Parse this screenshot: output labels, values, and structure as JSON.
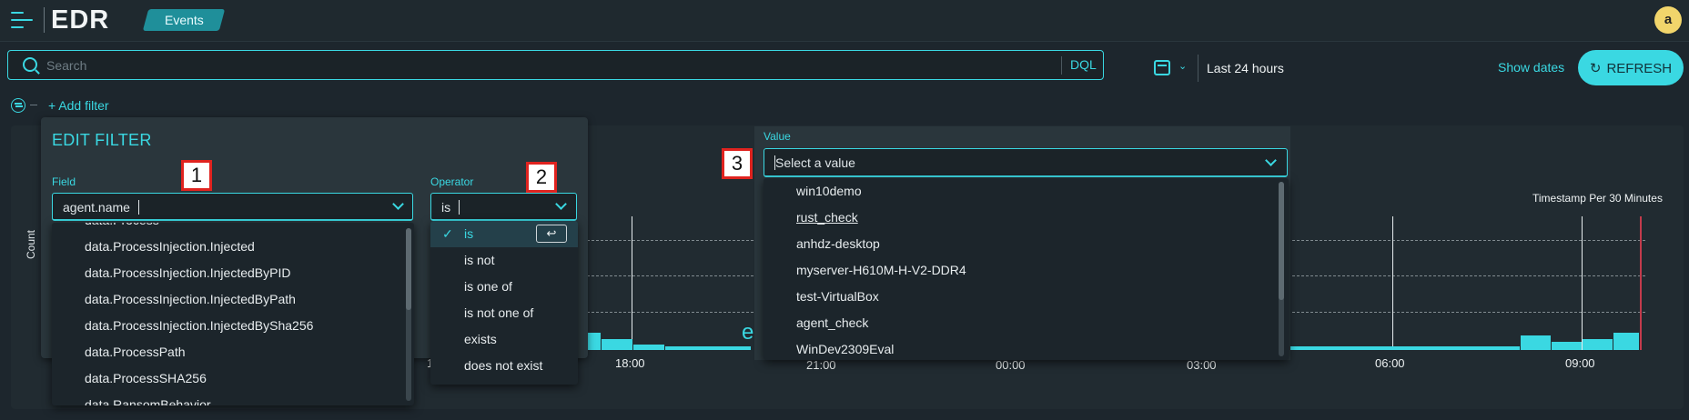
{
  "app": {
    "logo": "EDR",
    "section_tag": "Events",
    "avatar_initial": "a"
  },
  "search": {
    "placeholder": "Search",
    "dql_label": "DQL"
  },
  "time": {
    "range_label": "Last 24 hours",
    "show_dates_label": "Show dates",
    "refresh_label": "REFRESH"
  },
  "filters": {
    "add_filter_label": "+ Add filter"
  },
  "edit_filter": {
    "title": "EDIT FILTER",
    "field_label": "Field",
    "field_value": "agent.name",
    "operator_label": "Operator",
    "operator_value": "is",
    "field_options": [
      "data.Process",
      "data.ProcessInjection.Injected",
      "data.ProcessInjection.InjectedByPID",
      "data.ProcessInjection.InjectedByPath",
      "data.ProcessInjection.InjectedBySha256",
      "data.ProcessPath",
      "data.ProcessSHA256",
      "data.RansomBehavior"
    ],
    "operator_options": [
      "is",
      "is not",
      "is one of",
      "is not one of",
      "exists",
      "does not exist"
    ],
    "enter_key_symbol": "↩"
  },
  "value_select": {
    "label": "Value",
    "placeholder": "Select a value",
    "options": [
      "win10demo",
      "rust_check",
      "anhdz-desktop",
      "myserver-H610M-H-V2-DDR4",
      "test-VirtualBox",
      "agent_check",
      "WinDev2309Eval"
    ]
  },
  "markers": [
    "1",
    "2",
    "3"
  ],
  "chart_data": {
    "type": "bar",
    "ylabel": "Count",
    "xlabel": "Timestamp Per 30 Minutes",
    "tick_labels_visible": [
      "1",
      "18:00",
      "21:00",
      "00:00",
      "03:00",
      "06:00",
      "09:00"
    ],
    "partial_text": "er",
    "grid": true,
    "accent_color": "#3ad8e2",
    "current_time_line_color": "#c43b4c"
  },
  "colors": {
    "accent": "#3ad8e2",
    "background": "#1d262d",
    "panel": "#2a363c",
    "avatar": "#f1d56b",
    "marker_border": "#e0231f"
  }
}
